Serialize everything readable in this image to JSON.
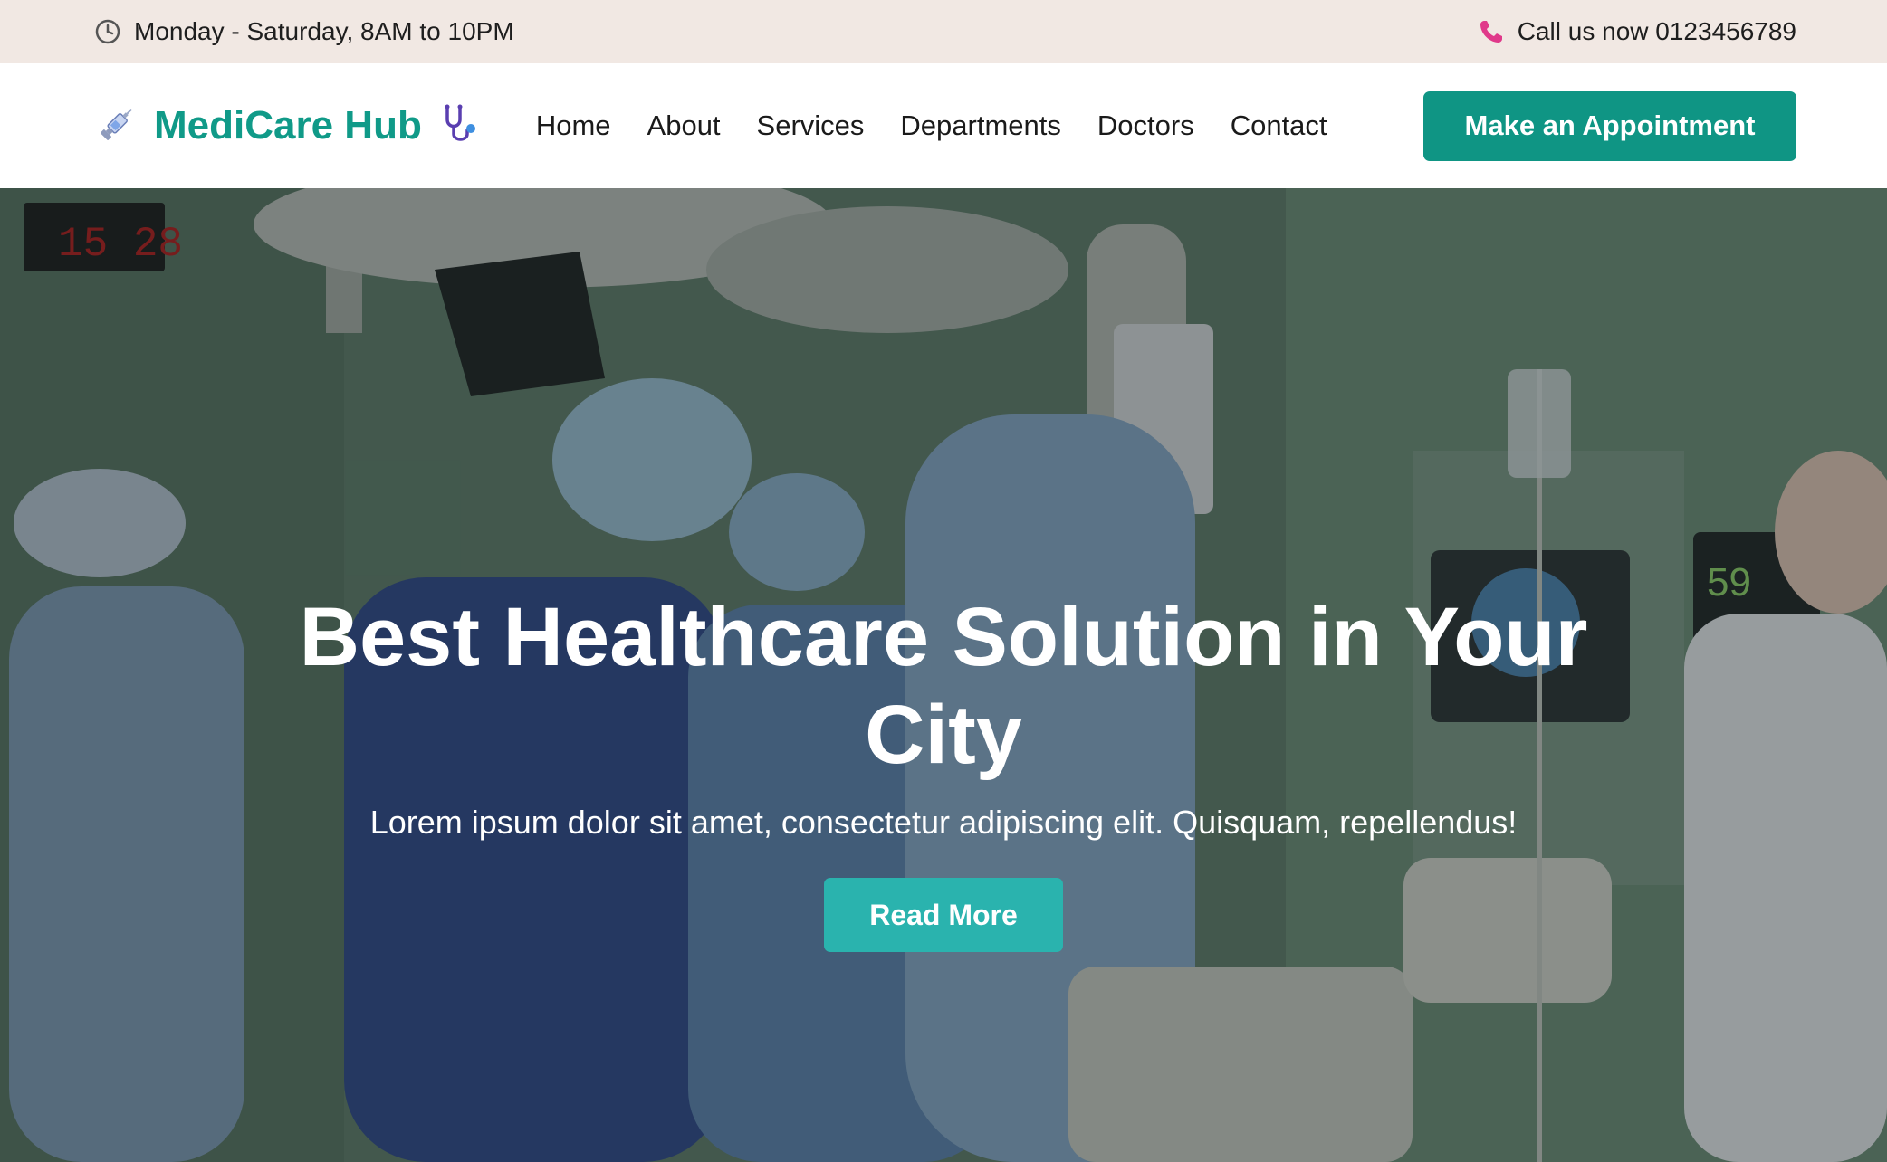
{
  "topbar": {
    "hours": "Monday - Saturday, 8AM to 10PM",
    "hours_icon": "clock-icon",
    "phone": "Call us now 0123456789",
    "phone_icon": "phone-icon"
  },
  "brand": {
    "name": "MediCare Hub",
    "left_icon": "syringe-icon",
    "right_icon": "stethoscope-icon",
    "color": "#109a88"
  },
  "nav": {
    "items": [
      {
        "label": "Home"
      },
      {
        "label": "About"
      },
      {
        "label": "Services"
      },
      {
        "label": "Departments"
      },
      {
        "label": "Doctors"
      },
      {
        "label": "Contact"
      }
    ],
    "cta_label": "Make an Appointment",
    "cta_color": "#0f9584"
  },
  "hero": {
    "title": "Best Healthcare Solution in Your City",
    "subtitle": "Lorem ipsum dolor sit amet, consectetur adipiscing elit. Quisquam, repellendus!",
    "button_label": "Read More",
    "button_color": "#2ab3ae",
    "background": "operating room photo"
  }
}
